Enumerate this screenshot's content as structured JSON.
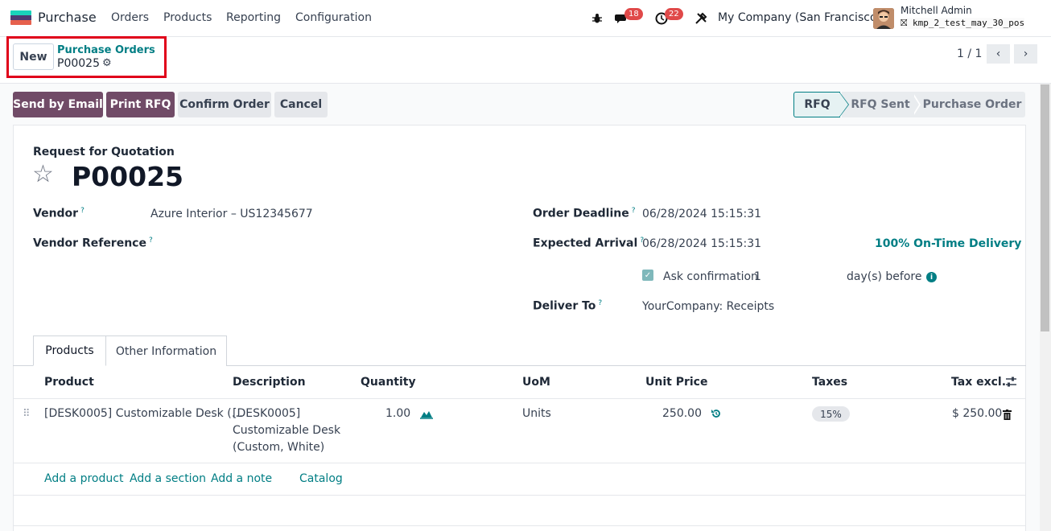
{
  "topnav": {
    "app_name": "Purchase",
    "menu": [
      "Orders",
      "Products",
      "Reporting",
      "Configuration"
    ],
    "messages_count": "18",
    "activities_count": "22",
    "company": "My Company (San Francisco)",
    "user_name": "Mitchell Admin",
    "database": "kmp_2_test_may_30_pos",
    "icons": [
      "bug-icon",
      "chat-icon",
      "clock-icon",
      "tools-icon"
    ]
  },
  "control": {
    "new_label": "New",
    "breadcrumb_parent": "Purchase Orders",
    "breadcrumb_current": "P00025",
    "pager": "1 / 1"
  },
  "actions": {
    "send_email": "Send by Email",
    "print_rfq": "Print RFQ",
    "confirm": "Confirm Order",
    "cancel": "Cancel"
  },
  "statusbar": {
    "steps": [
      "RFQ",
      "RFQ Sent",
      "Purchase Order"
    ],
    "active": "RFQ"
  },
  "form": {
    "doc_type": "Request for Quotation",
    "doc_name": "P00025",
    "vendor_label": "Vendor",
    "vendor_value": "Azure Interior – US12345677",
    "vendor_ref_label": "Vendor Reference",
    "vendor_ref_value": "",
    "order_deadline_label": "Order Deadline",
    "order_deadline_value": "06/28/2024 15:15:31",
    "expected_arrival_label": "Expected Arrival",
    "expected_arrival_value": "06/28/2024 15:15:31",
    "on_time": "100% On-Time Delivery",
    "ask_confirmation_label": "Ask confirmation",
    "ask_confirmation_days": "1",
    "days_before": "day(s) before",
    "deliver_to_label": "Deliver To",
    "deliver_to_value": "YourCompany: Receipts",
    "tooltip_mark": "?"
  },
  "tabs": [
    "Products",
    "Other Information"
  ],
  "table": {
    "headers": [
      "Product",
      "Description",
      "Quantity",
      "UoM",
      "Unit Price",
      "Taxes",
      "Tax excl."
    ],
    "rows": [
      {
        "product": "[DESK0005] Customizable Desk (…",
        "description": [
          "[DESK0005]",
          "Customizable Desk",
          "(Custom, White)"
        ],
        "quantity": "1.00",
        "uom": "Units",
        "unit_price": "250.00",
        "taxes": "15%",
        "tax_excl": "$ 250.00"
      }
    ],
    "links": [
      "Add a product",
      "Add a section",
      "Add a note",
      "Catalog"
    ]
  }
}
